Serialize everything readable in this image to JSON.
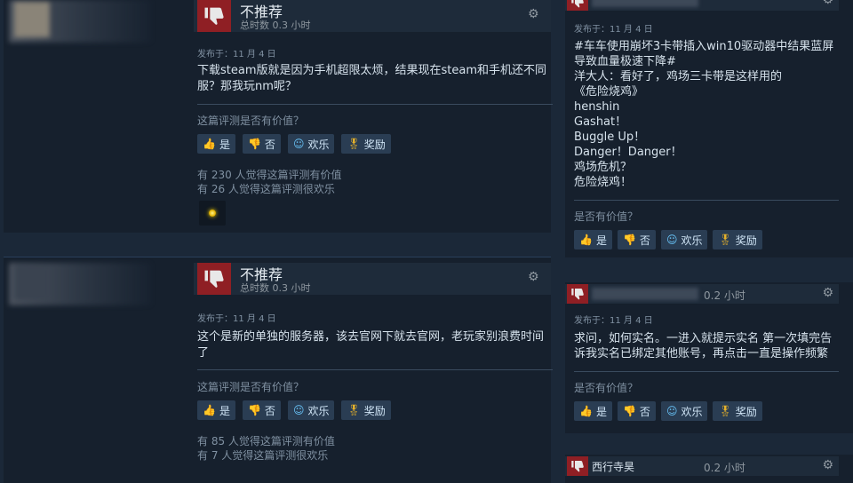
{
  "left_reviews": [
    {
      "verdict": "不推荐",
      "hours": "总时数 0.3 小时",
      "posted": "发布于：11 月 4 日",
      "text_lines": [
        "下载steam版就是因为手机超限太烦，结果现在steam和手机还不同",
        "服？那我玩nm呢？"
      ],
      "helpful_question": "这篇评测是否有价值？",
      "votes": {
        "yes": "是",
        "no": "否",
        "funny": "欢乐",
        "award": "奖励"
      },
      "helpful_count": "有 230 人觉得这篇评测有价值",
      "funny_count": "有 26 人觉得这篇评测很欢乐"
    },
    {
      "verdict": "不推荐",
      "hours": "总时数 0.3 小时",
      "posted": "发布于：11 月 4 日",
      "text_lines": [
        "这个是新的单独的服务器，该去官网下就去官网，老玩家别浪费时间",
        "了"
      ],
      "helpful_question": "这篇评测是否有价值？",
      "votes": {
        "yes": "是",
        "no": "否",
        "funny": "欢乐",
        "award": "奖励"
      },
      "helpful_count": "有 85 人觉得这篇评测有价值",
      "funny_count": "有 7 人觉得这篇评测很欢乐"
    }
  ],
  "right_reviews": [
    {
      "posted": "发布于：11 月 4 日",
      "text_lines": [
        "#车车使用崩坏3卡带插入win10驱动器中结果蓝屏",
        "导致血量极速下降#",
        "洋大人：看好了，鸡场三卡带是这样用的",
        "《危险烧鸡》",
        "henshin",
        "Gashat！",
        "Buggle Up！",
        "Danger！Danger！",
        "鸡场危机？",
        "危险烧鸡！"
      ],
      "helpful_question": "是否有价值？",
      "votes": {
        "yes": "是",
        "no": "否",
        "funny": "欢乐",
        "award": "奖励"
      }
    },
    {
      "hours": "0.2 小时",
      "posted": "发布于：11 月 4 日",
      "text_lines": [
        "求问，如何实名。一进入就提示实名 第一次填完告",
        "诉我实名已绑定其他账号，再点击一直是操作频繁"
      ],
      "helpful_question": "是否有价值？",
      "votes": {
        "yes": "是",
        "no": "否",
        "funny": "欢乐",
        "award": "奖励"
      }
    },
    {
      "author": "西行寺昊",
      "hours": "0.2 小时"
    }
  ],
  "colors": {
    "background": "#1b2838",
    "card": "#16202d",
    "not_recommended": "#8f1f24",
    "link_blue": "#67c1f5"
  }
}
